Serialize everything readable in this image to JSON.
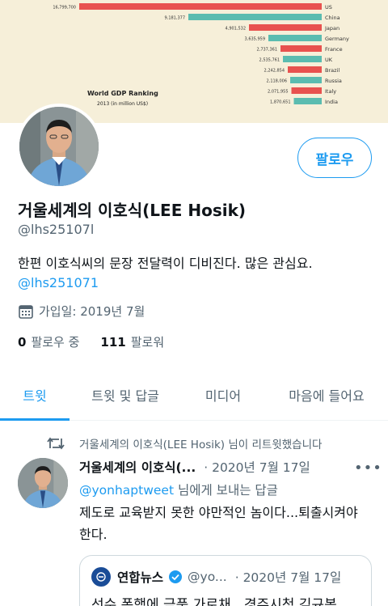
{
  "banner": {
    "title": "World GDP Ranking",
    "subtitle": "2013 (in million US$)",
    "rows": [
      {
        "country": "US",
        "value": "16,799,700",
        "color": "#e8524f",
        "fraction": 1.0
      },
      {
        "country": "China",
        "value": "9,181,377",
        "color": "#5bbcb0",
        "fraction": 0.55
      },
      {
        "country": "Japan",
        "value": "4,901,532",
        "color": "#e8524f",
        "fraction": 0.3
      },
      {
        "country": "Germany",
        "value": "3,635,959",
        "color": "#5bbcb0",
        "fraction": 0.22
      },
      {
        "country": "France",
        "value": "2,737,361",
        "color": "#e8524f",
        "fraction": 0.17
      },
      {
        "country": "UK",
        "value": "2,535,761",
        "color": "#5bbcb0",
        "fraction": 0.16
      },
      {
        "country": "Brazil",
        "value": "2,242,854",
        "color": "#e8524f",
        "fraction": 0.14
      },
      {
        "country": "Russia",
        "value": "2,118,006",
        "color": "#5bbcb0",
        "fraction": 0.13
      },
      {
        "country": "Italy",
        "value": "2,071,955",
        "color": "#e8524f",
        "fraction": 0.125
      },
      {
        "country": "India",
        "value": "1,870,651",
        "color": "#5bbcb0",
        "fraction": 0.115
      }
    ]
  },
  "profile": {
    "follow_label": "팔로우",
    "display_name": "거울세계의 이호식(LEE Hosik)",
    "handle": "@lhs25107l",
    "bio": "한편 이호식씨의 문장 전달력이 디비진다. 많은 관심요.",
    "bio_link": "@lhs251071",
    "joined": "가입일: 2019년 7월",
    "following_count": "0",
    "following_label": "팔로우 중",
    "followers_count": "111",
    "followers_label": "팔로워"
  },
  "tabs": [
    "트윗",
    "트윗 및 답글",
    "미디어",
    "마음에 들어요"
  ],
  "tweet": {
    "retweet_text": "거울세계의 이호식(LEE Hosik) 님이 리트윗했습니다",
    "author": "거울세계의 이호식(...",
    "date": "· 2020년 7월 17일",
    "more": "•••",
    "reply_to": "@yonhaptweet",
    "reply_suffix": " 님에게 보내는 답글",
    "body": "제도로 교육받지 못한 야만적인 놈이다...퇴출시켜야 한다.",
    "quote": {
      "name": "연합뉴스",
      "handle": "@yo...",
      "date": "· 2020년 7월 17일",
      "body": "선수 폭행에 금품 가로채...경주시청 김규봉"
    }
  },
  "colors": {
    "accent": "#1d9bf0",
    "secondary_text": "#536471"
  }
}
